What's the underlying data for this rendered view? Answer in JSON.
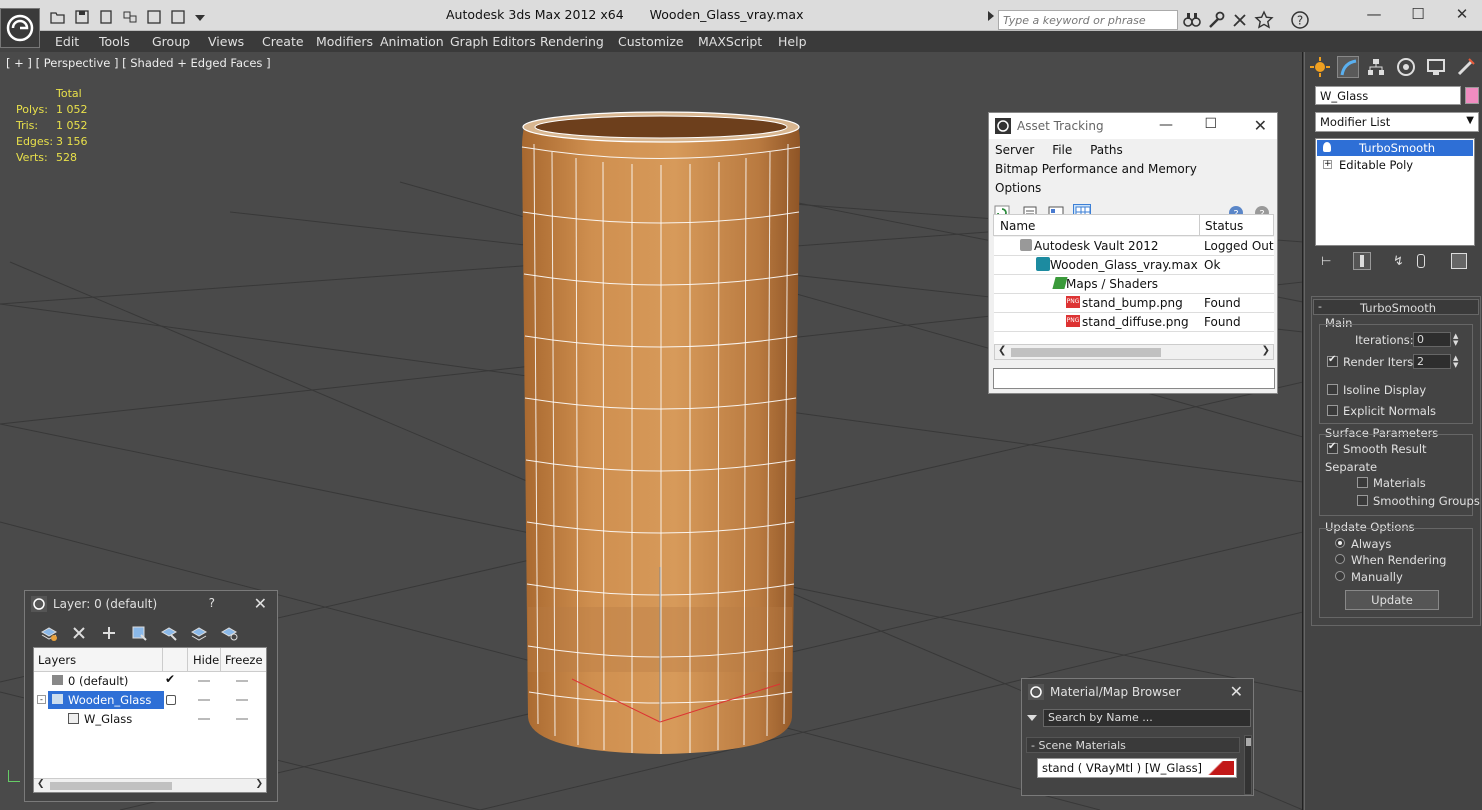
{
  "titlebar": {
    "app_title": "Autodesk 3ds Max  2012 x64",
    "file_name": "Wooden_Glass_vray.max",
    "search_placeholder": "Type a keyword or phrase"
  },
  "menu": [
    "Edit",
    "Tools",
    "Group",
    "Views",
    "Create",
    "Modifiers",
    "Animation",
    "Graph Editors",
    "Rendering",
    "Customize",
    "MAXScript",
    "Help"
  ],
  "viewport": {
    "label": "[ + ] [ Perspective ] [ Shaded + Edged Faces ]",
    "stats_header": "Total",
    "stats": [
      {
        "label": "Polys:",
        "value": "1 052"
      },
      {
        "label": "Tris:",
        "value": "1 052"
      },
      {
        "label": "Edges:",
        "value": "3 156"
      },
      {
        "label": "Verts:",
        "value": "528"
      }
    ]
  },
  "asset_tracking": {
    "title": "Asset Tracking",
    "menu1": [
      "Server",
      "File",
      "Paths"
    ],
    "menu2": [
      "Bitmap Performance and Memory",
      "Options"
    ],
    "col_name": "Name",
    "col_status": "Status",
    "rows": [
      {
        "name": "Autodesk Vault 2012",
        "status": "Logged Out ..."
      },
      {
        "name": "Wooden_Glass_vray.max",
        "status": "Ok"
      },
      {
        "name": "Maps / Shaders",
        "status": ""
      },
      {
        "name": "stand_bump.png",
        "status": "Found"
      },
      {
        "name": "stand_diffuse.png",
        "status": "Found"
      }
    ]
  },
  "layer_window": {
    "title": "Layer: 0 (default)",
    "help": "?",
    "col_layers": "Layers",
    "col_hide": "Hide",
    "col_freeze": "Freeze",
    "rows": [
      {
        "name": "0 (default)"
      },
      {
        "name": "Wooden_Glass"
      },
      {
        "name": "W_Glass"
      }
    ]
  },
  "material_browser": {
    "title": "Material/Map Browser",
    "search_placeholder": "Search by Name ...",
    "section": "- Scene Materials",
    "item": "stand  ( VRayMtl )  [W_Glass]"
  },
  "command_panel": {
    "object_name": "W_Glass",
    "object_color": "#f08cc0",
    "modifier_list": "Modifier List",
    "stack": [
      "TurboSmooth",
      "Editable Poly"
    ],
    "rollout_title": "TurboSmooth",
    "main_label": "Main",
    "iterations_label": "Iterations:",
    "iterations_value": "0",
    "render_iters_label": "Render Iters:",
    "render_iters_value": "2",
    "isoline_label": "Isoline Display",
    "explicit_normals_label": "Explicit Normals",
    "surface_params_label": "Surface Parameters",
    "smooth_result_label": "Smooth Result",
    "separate_label": "Separate",
    "materials_label": "Materials",
    "smoothing_groups_label": "Smoothing Groups",
    "update_options_label": "Update Options",
    "always_label": "Always",
    "when_rendering_label": "When Rendering",
    "manually_label": "Manually",
    "update_button": "Update"
  }
}
